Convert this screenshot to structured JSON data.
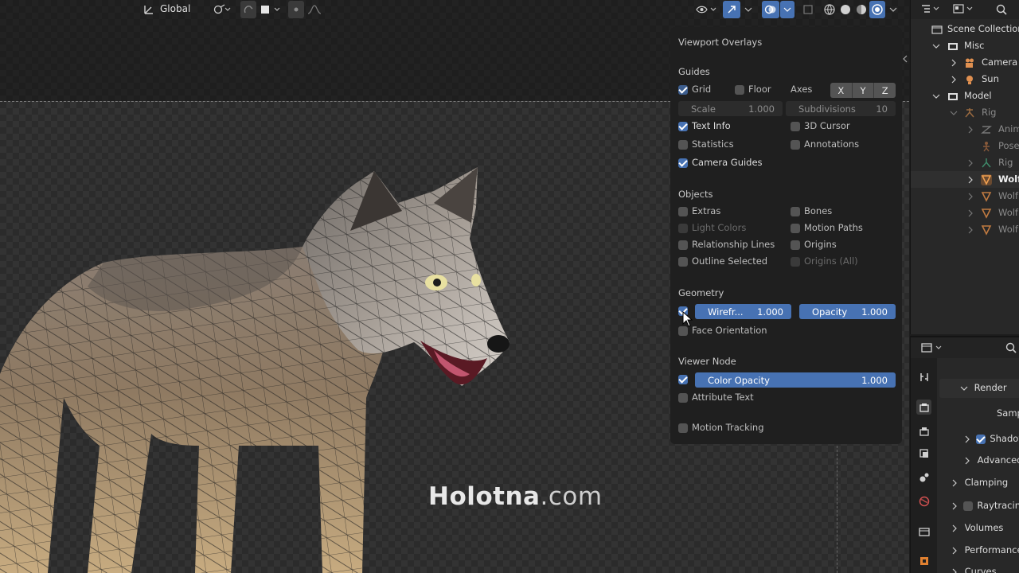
{
  "header": {
    "transform_orientation": "Global"
  },
  "overlay": {
    "title": "Viewport Overlays",
    "guides": {
      "heading": "Guides",
      "grid": {
        "label": "Grid",
        "checked": true
      },
      "floor": {
        "label": "Floor",
        "checked": false
      },
      "axes_label": "Axes",
      "axes": [
        "X",
        "Y",
        "Z"
      ],
      "scale": {
        "label": "Scale",
        "value": "1.000"
      },
      "subdivisions": {
        "label": "Subdivisions",
        "value": "10"
      },
      "text_info": {
        "label": "Text Info",
        "checked": true
      },
      "cursor_3d": {
        "label": "3D Cursor",
        "checked": false
      },
      "statistics": {
        "label": "Statistics",
        "checked": false
      },
      "annotations": {
        "label": "Annotations",
        "checked": false
      },
      "camera_guides": {
        "label": "Camera Guides",
        "checked": true
      }
    },
    "objects": {
      "heading": "Objects",
      "extras": {
        "label": "Extras",
        "checked": false
      },
      "bones": {
        "label": "Bones",
        "checked": false
      },
      "light_colors": {
        "label": "Light Colors",
        "checked": false,
        "disabled": true
      },
      "motion_paths": {
        "label": "Motion Paths",
        "checked": false
      },
      "relationship_lines": {
        "label": "Relationship Lines",
        "checked": false
      },
      "origins": {
        "label": "Origins",
        "checked": false
      },
      "outline_selected": {
        "label": "Outline Selected",
        "checked": false
      },
      "origins_all": {
        "label": "Origins (All)",
        "checked": false,
        "disabled": true
      }
    },
    "geometry": {
      "heading": "Geometry",
      "wireframe": {
        "checked": true,
        "label": "Wirefr...",
        "value": "1.000"
      },
      "opacity": {
        "label": "Opacity",
        "value": "1.000"
      },
      "face_orientation": {
        "label": "Face Orientation",
        "checked": false
      }
    },
    "viewer_node": {
      "heading": "Viewer Node",
      "color_opacity": {
        "checked": true,
        "label": "Color Opacity",
        "value": "1.000"
      },
      "attribute_text": {
        "label": "Attribute Text",
        "checked": false
      }
    },
    "motion_tracking": {
      "label": "Motion Tracking",
      "checked": false
    }
  },
  "outliner": {
    "items": [
      {
        "label": "Scene Collection",
        "icon": "scene-collection-icon"
      },
      {
        "label": "Misc",
        "icon": "collection-icon"
      },
      {
        "label": "Camera",
        "icon": "camera-icon"
      },
      {
        "label": "Sun",
        "icon": "light-icon"
      },
      {
        "label": "Model",
        "icon": "collection-icon"
      },
      {
        "label": "Rig",
        "icon": "armature-icon"
      },
      {
        "label": "Anim",
        "icon": "animation-icon"
      },
      {
        "label": "Pose",
        "icon": "pose-icon"
      },
      {
        "label": "Rig",
        "icon": "armature-data-icon"
      },
      {
        "label": "Wolf",
        "icon": "mesh-icon"
      },
      {
        "label": "Wolf",
        "icon": "mesh-icon"
      },
      {
        "label": "Wolf",
        "icon": "mesh-icon"
      },
      {
        "label": "Wolf",
        "icon": "mesh-icon"
      }
    ]
  },
  "properties": {
    "render_panel": "Render",
    "samples_label": "Samp",
    "shadows": {
      "label": "Shadow",
      "checked": true
    },
    "advanced": "Advanced",
    "clamping": "Clamping",
    "raytracing": {
      "label": "Raytracing",
      "checked": false
    },
    "volumes": "Volumes",
    "performance": "Performance",
    "curves": "Curves"
  },
  "watermark": {
    "bold": "Holotna",
    "rest": ".com"
  },
  "colors": {
    "accent": "#4772b3",
    "panel": "#1f1f1f",
    "checkbox_off": "#545454"
  }
}
